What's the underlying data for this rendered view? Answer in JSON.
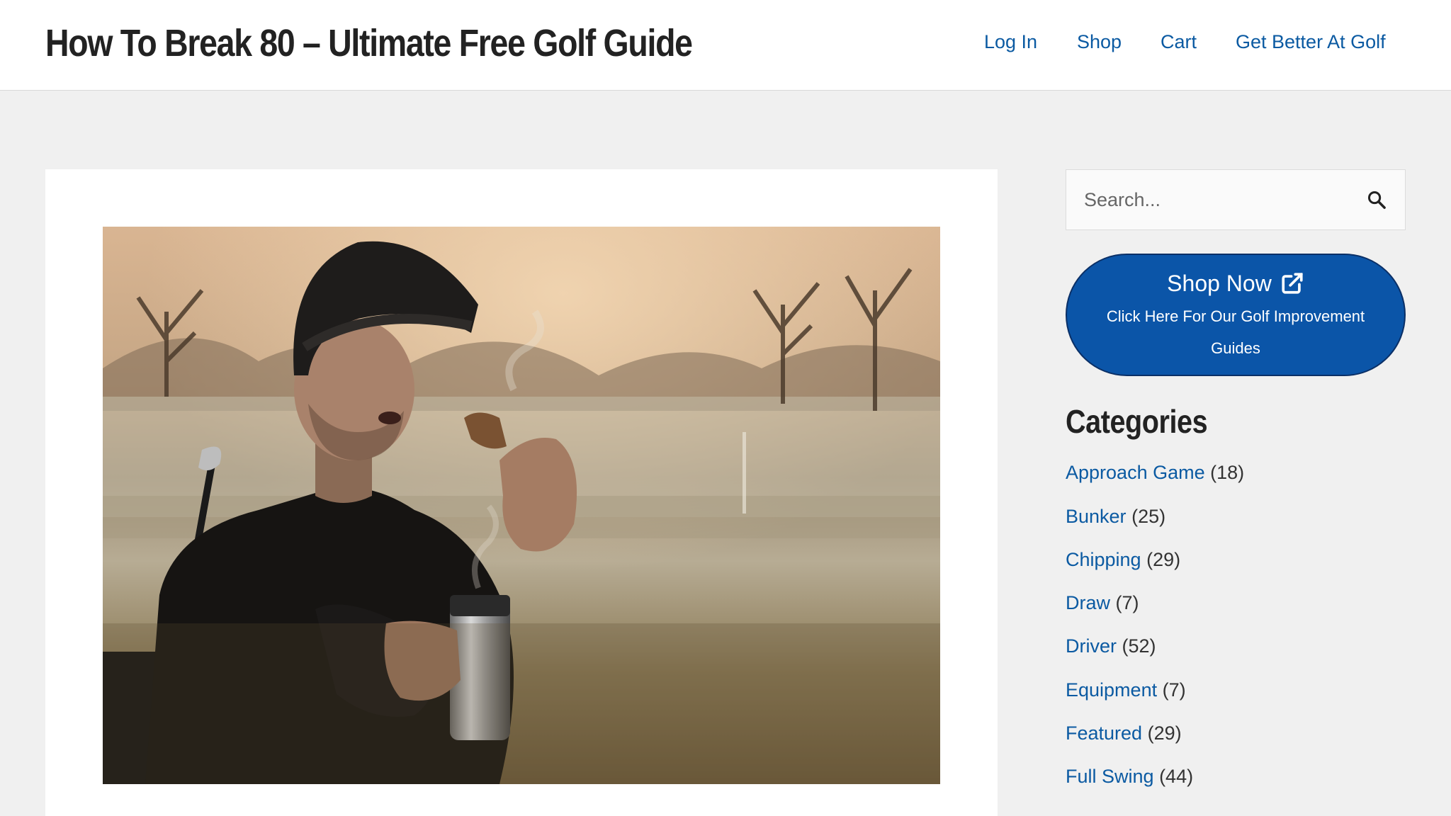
{
  "header": {
    "site_title": "How To Break 80 – Ultimate Free Golf Guide",
    "nav": [
      {
        "label": "Log In"
      },
      {
        "label": "Shop"
      },
      {
        "label": "Cart"
      },
      {
        "label": "Get Better At Golf"
      }
    ]
  },
  "main": {
    "hero_image": {
      "description_icon": "photo-golfer-eating-snack"
    }
  },
  "sidebar": {
    "search": {
      "placeholder": "Search...",
      "icon": "search-icon"
    },
    "shop_button": {
      "title": "Shop Now",
      "subtitle": "Click Here For Our Golf Improvement Guides",
      "icon": "external-link-icon"
    },
    "categories": {
      "heading": "Categories",
      "items": [
        {
          "label": "Approach Game",
          "count": "(18)"
        },
        {
          "label": "Bunker",
          "count": "(25)"
        },
        {
          "label": "Chipping",
          "count": "(29)"
        },
        {
          "label": "Draw",
          "count": "(7)"
        },
        {
          "label": "Driver",
          "count": "(52)"
        },
        {
          "label": "Equipment",
          "count": "(7)"
        },
        {
          "label": "Featured",
          "count": "(29)"
        },
        {
          "label": "Full Swing",
          "count": "(44)"
        }
      ]
    }
  },
  "colors": {
    "link": "#0b5aa2",
    "button": "#0b55a8",
    "background": "#f0f0f0"
  }
}
